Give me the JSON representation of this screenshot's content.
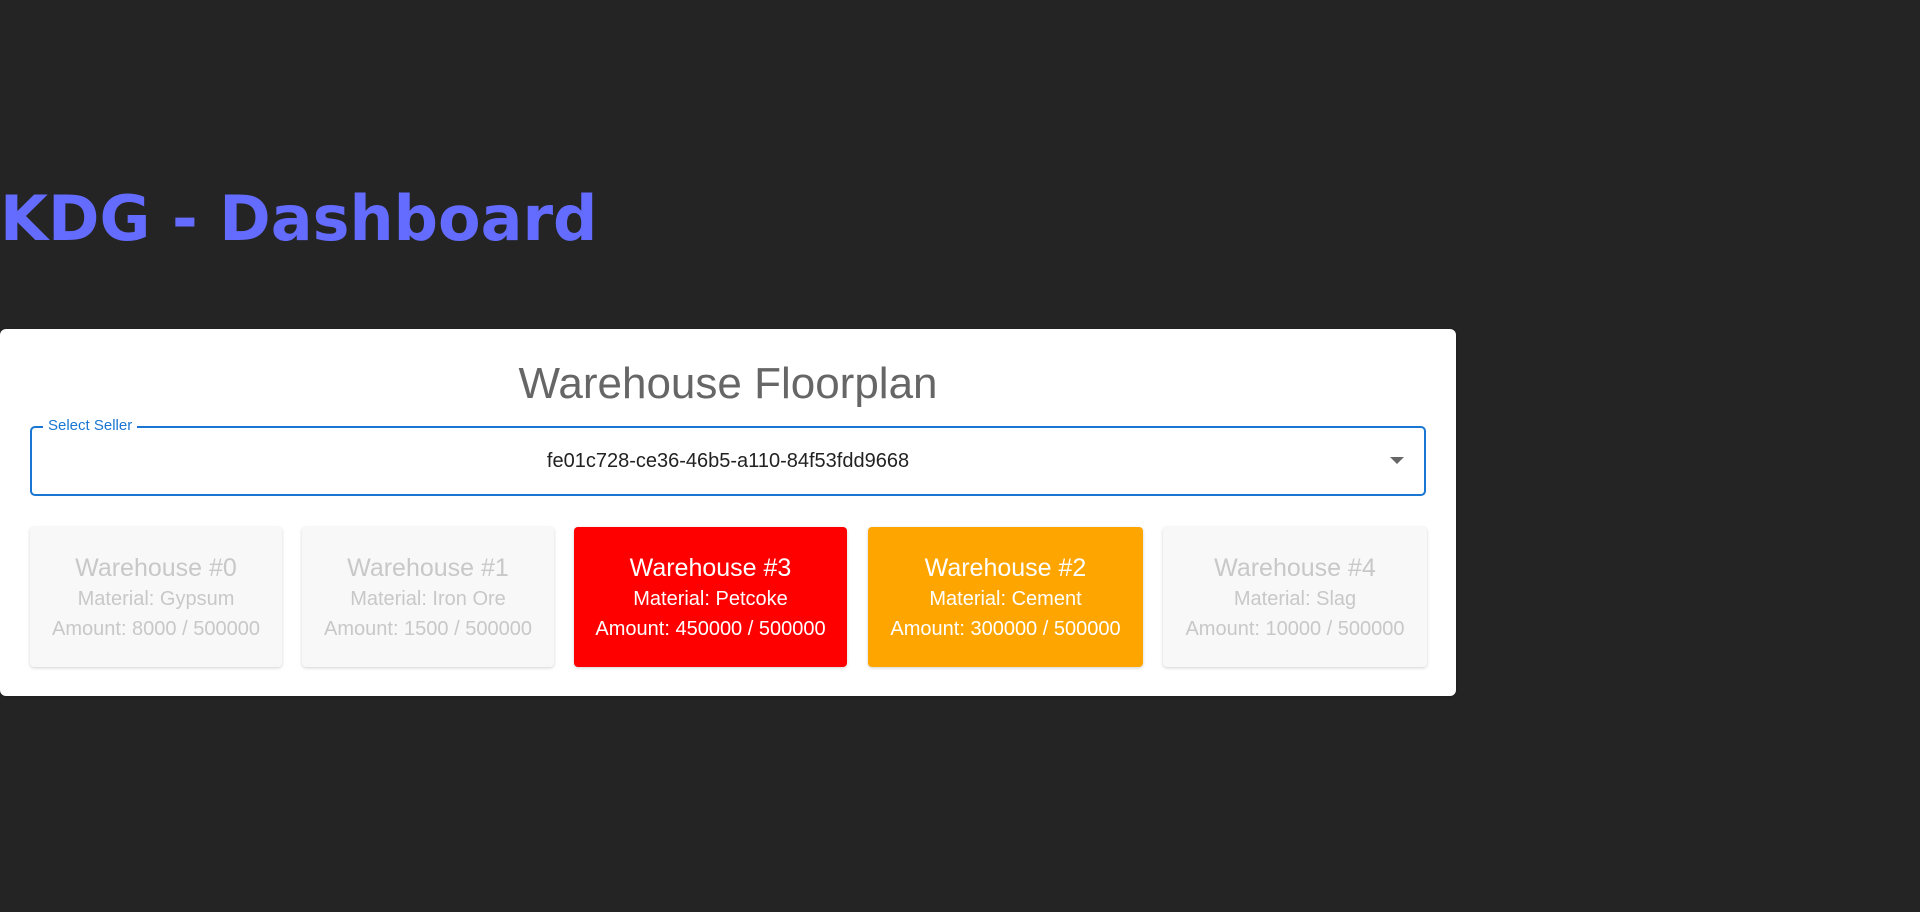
{
  "header": {
    "title": "KDG - Dashboard"
  },
  "floorplan": {
    "title": "Warehouse Floorplan",
    "select": {
      "label": "Select Seller",
      "value": "fe01c728-ce36-46b5-a110-84f53fdd9668",
      "arrow_icon": "arrow-drop-down-icon"
    },
    "warehouses": [
      {
        "name": "Warehouse #0",
        "material": "Material: Gypsum",
        "amount": "Amount: 8000 / 500000",
        "state": "inactive",
        "color": "#f8f8f8"
      },
      {
        "name": "Warehouse #1",
        "material": "Material: Iron Ore",
        "amount": "Amount: 1500 / 500000",
        "state": "inactive",
        "color": "#f8f8f8"
      },
      {
        "name": "Warehouse #3",
        "material": "Material: Petcoke",
        "amount": "Amount: 450000 / 500000",
        "state": "critical",
        "color": "#ff0000"
      },
      {
        "name": "Warehouse #2",
        "material": "Material: Cement",
        "amount": "Amount: 300000 / 500000",
        "state": "warning",
        "color": "#ffa500"
      },
      {
        "name": "Warehouse #4",
        "material": "Material: Slag",
        "amount": "Amount: 10000 / 500000",
        "state": "inactive",
        "color": "#f8f8f8"
      }
    ]
  },
  "colors": {
    "background": "#242424",
    "title_accent": "#646cff",
    "select_border": "#1976d2"
  }
}
